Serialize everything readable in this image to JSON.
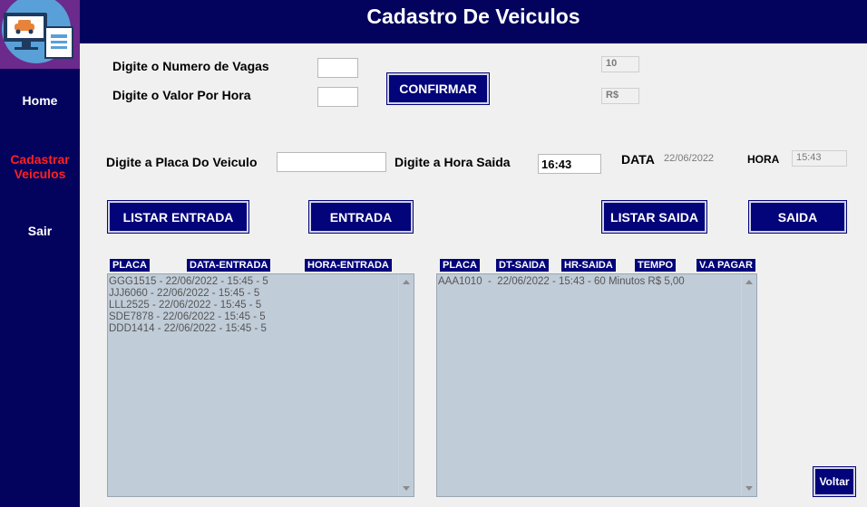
{
  "window": {
    "title": "Cadastro De Veiculos"
  },
  "sidebar": {
    "logo_icon": "computer-car-icon",
    "items": [
      {
        "label": "Home",
        "color": "#ffffff"
      },
      {
        "label": "Cadastrar Veiculos",
        "color": "#ff2020"
      },
      {
        "label": "Sair",
        "color": "#ffffff"
      }
    ]
  },
  "form": {
    "vagas_label": "Digite o Numero de Vagas",
    "vagas_value": "",
    "valor_label": "Digite o Valor Por Hora",
    "valor_value": "",
    "confirmar_label": "CONFIRMAR",
    "vagas_display": "10",
    "valor_display": "R$",
    "placa_label": "Digite a Placa Do Veiculo",
    "placa_value": "",
    "hora_saida_label": "Digite a Hora Saida",
    "hora_saida_value": "16:43",
    "data_label": "DATA",
    "data_value": "22/06/2022",
    "hora_label": "HORA",
    "hora_value": "15:43"
  },
  "buttons": {
    "listar_entrada": "LISTAR ENTRADA",
    "entrada": "ENTRADA",
    "listar_saida": "LISTAR SAIDA",
    "saida": "SAIDA",
    "voltar": "Voltar"
  },
  "entrada_list": {
    "headers": [
      "PLACA",
      "DATA-ENTRADA",
      "HORA-ENTRADA"
    ],
    "rows": [
      "GGG1515 - 22/06/2022 - 15:45 - 5",
      "JJJ6060 - 22/06/2022 - 15:45 - 5",
      "LLL2525 - 22/06/2022 - 15:45 - 5",
      "SDE7878 - 22/06/2022 - 15:45 - 5",
      "DDD1414 - 22/06/2022 - 15:45 - 5"
    ]
  },
  "saida_list": {
    "headers": [
      "PLACA",
      "DT-SAIDA",
      "HR-SAIDA",
      "TEMPO",
      "V.A PAGAR"
    ],
    "rows": [
      "AAA1010  -  22/06/2022 - 15:43 - 60 Minutos R$ 5,00"
    ]
  },
  "colors": {
    "navy": "#03035e",
    "button": "#03037a",
    "active_nav": "#ff2020",
    "list_bg": "#c0ccd8"
  }
}
